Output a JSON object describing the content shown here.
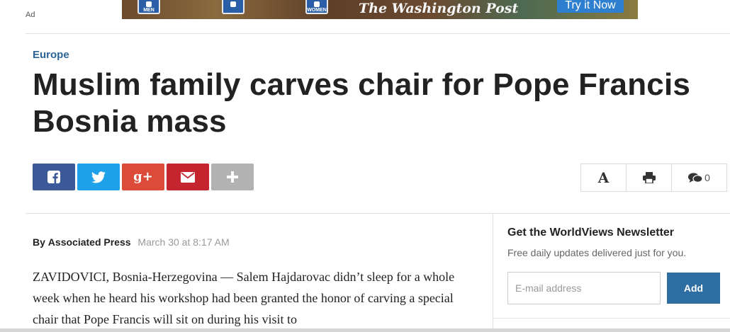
{
  "ad": {
    "label": "Ad",
    "sign_men": "MEN",
    "sign_women": "WOMEN",
    "brand": "The Washington Post",
    "cta": "Try it Now"
  },
  "article": {
    "section": "Europe",
    "headline": "Muslim family carves chair for Pope Francis Bosnia mass",
    "byline_prefix": "By",
    "author": "Associated Press",
    "timestamp": "March 30 at 8:17 AM",
    "body": "ZAVIDOVICI, Bosnia-Herzegovina — Salem Hajdarovac didn’t sleep for a whole week when he heard his workshop had been granted the honor of carving a special chair that Pope Francis will sit on during his visit to"
  },
  "share": {
    "buttons": [
      "facebook-icon",
      "twitter-icon",
      "google-plus-icon",
      "envelope-icon",
      "plus-icon"
    ],
    "google_plus_label": "g+",
    "colors": {
      "facebook": "#3b5998",
      "twitter": "#1ea1e8",
      "google_plus": "#dc4a38",
      "email": "#c5252f",
      "more": "#b2b2b2"
    }
  },
  "tools": {
    "font_label": "A",
    "comment_count": "0"
  },
  "newsletter": {
    "title": "Get the WorldViews Newsletter",
    "subtitle": "Free daily updates delivered just for you.",
    "email_placeholder": "E-mail address",
    "add_label": "Add",
    "accent_color": "#2f6ea3"
  }
}
